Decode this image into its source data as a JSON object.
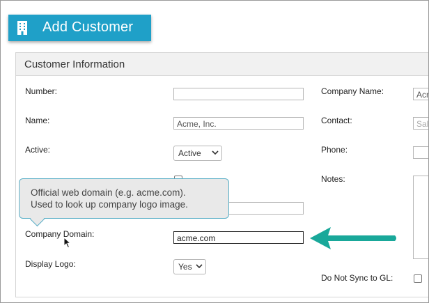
{
  "header": {
    "title": "Add Customer",
    "icon": "building-icon",
    "accent": "#1fa0c8"
  },
  "section": {
    "title": "Customer Information"
  },
  "left_fields": {
    "number": {
      "label": "Number:",
      "value": ""
    },
    "name": {
      "label": "Name:",
      "value": "Acme, Inc."
    },
    "active": {
      "label": "Active:",
      "value": "Active"
    },
    "company_domain": {
      "label": "Company Domain:",
      "value": "acme.com"
    },
    "display_logo": {
      "label": "Display Logo:",
      "value": "Yes"
    }
  },
  "right_fields": {
    "company_name": {
      "label": "Company Name:",
      "value": "Acr"
    },
    "contact": {
      "label": "Contact:",
      "placeholder": "Sal"
    },
    "phone": {
      "label": "Phone:",
      "value": ""
    },
    "notes": {
      "label": "Notes:",
      "value": ""
    },
    "do_not_sync": {
      "label": "Do Not Sync to GL:",
      "checked": false
    }
  },
  "tooltip": {
    "line1": "Official web domain (e.g. acme.com).",
    "line2": "Used to look up company logo image."
  },
  "annotation": {
    "arrow_color": "#19a89a",
    "icon": "arrow-left-icon"
  }
}
